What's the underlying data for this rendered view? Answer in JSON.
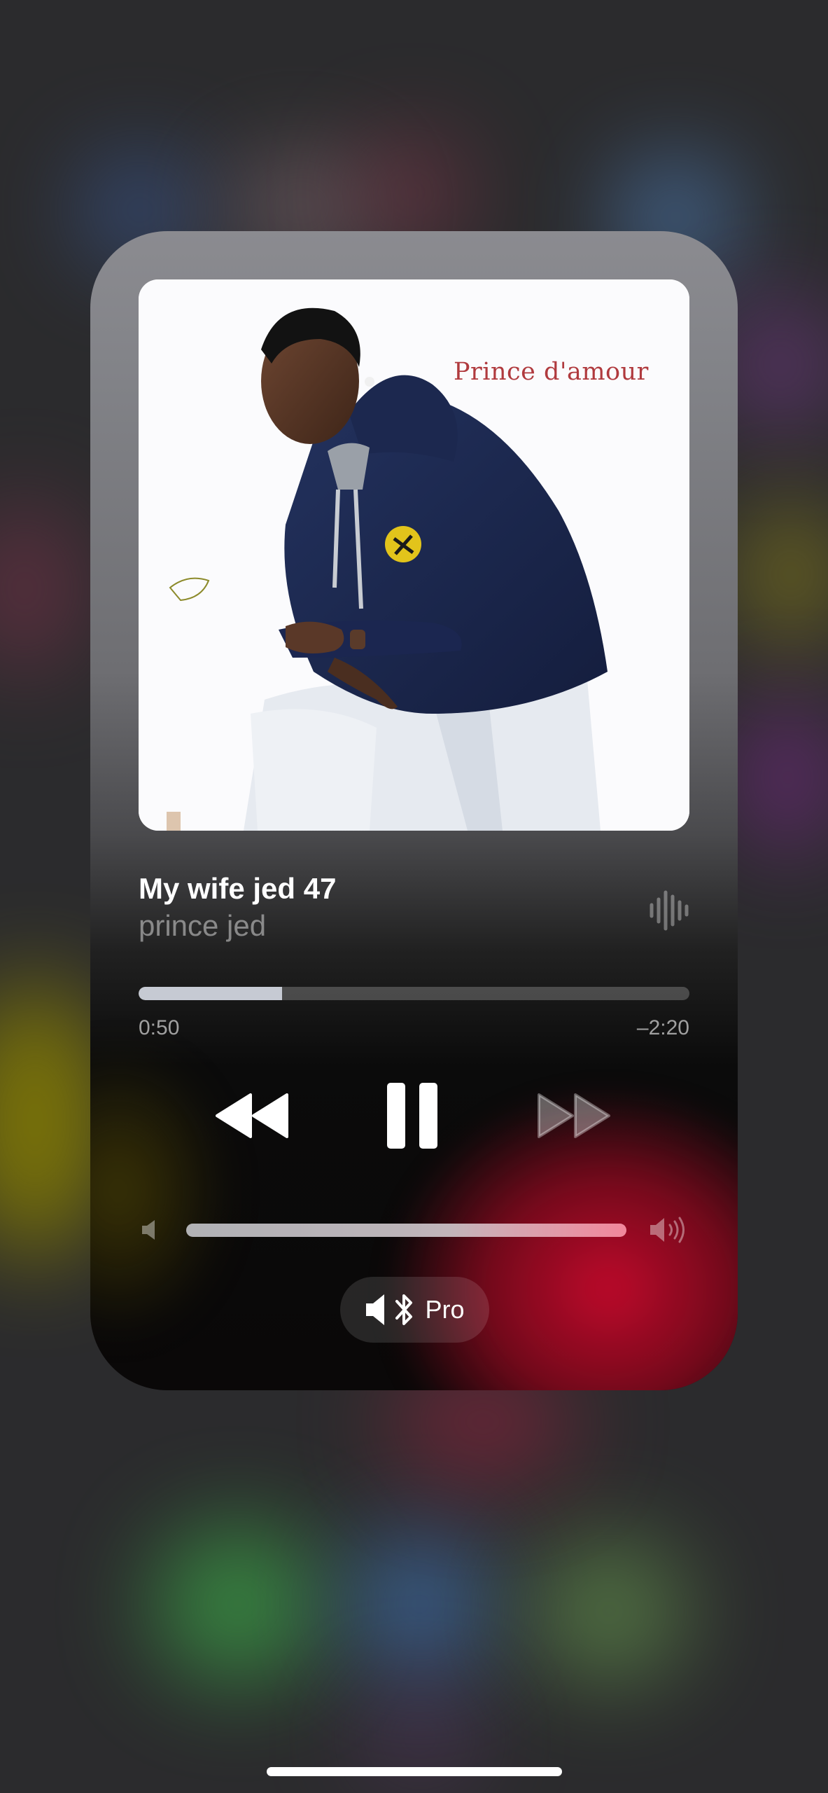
{
  "now_playing": {
    "artwork_caption": "Prince d'amour",
    "title": "My wife jed 47",
    "artist": "prince jed"
  },
  "playback": {
    "elapsed": "0:50",
    "remaining": "–2:20",
    "progress_fraction": 0.26
  },
  "controls": {
    "rewind_icon": "backward-icon",
    "pause_icon": "pause-icon",
    "forward_icon": "forward-icon"
  },
  "volume": {
    "level_fraction": 1.0
  },
  "audio_route": {
    "label": "Pro",
    "icon": "speaker-bluetooth-icon"
  },
  "colors": {
    "accent_red": "#c80a2d",
    "text_primary": "#ffffff",
    "text_secondary": "#8e8e93"
  }
}
